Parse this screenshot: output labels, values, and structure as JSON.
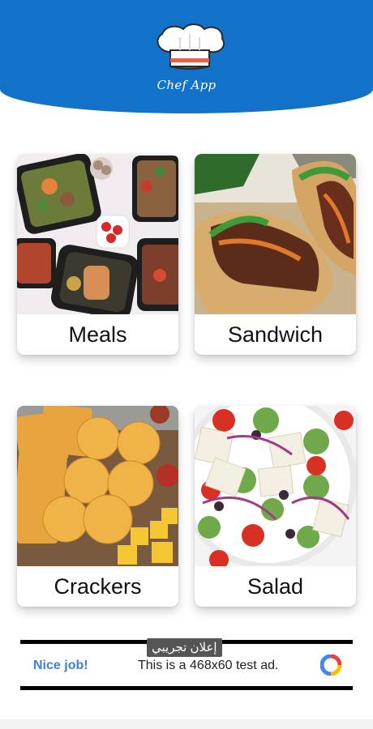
{
  "header": {
    "app_name": "Chef App",
    "logo_icon": "chef-hat-icon",
    "background_color": "#1272c9"
  },
  "categories": [
    {
      "label": "Meals",
      "image": "meal-prep-containers-photo"
    },
    {
      "label": "Sandwich",
      "image": "banh-mi-sandwich-photo"
    },
    {
      "label": "Crackers",
      "image": "crackers-and-cheese-photo"
    },
    {
      "label": "Salad",
      "image": "greek-salad-photo"
    }
  ],
  "ad": {
    "nice_job": "Nice job!",
    "text": "This is a 468x60 test ad.",
    "badge": "إعلان تجريبي",
    "logo_icon": "ad-choices-logo-icon"
  }
}
